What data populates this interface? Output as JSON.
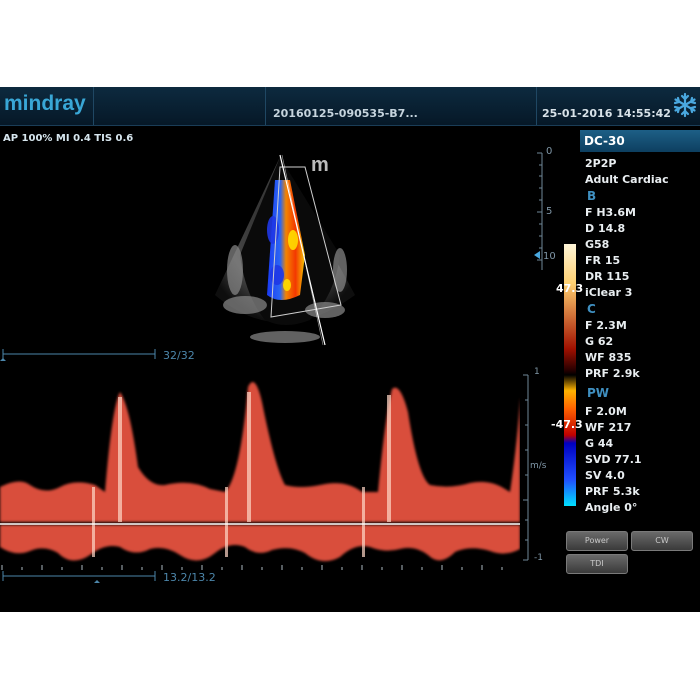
{
  "header": {
    "brand": "mindray",
    "study_id": "20160125-090535-B7...",
    "datetime": "25-01-2016 14:55:42",
    "freeze_icon": "snowflake-icon"
  },
  "acoustic": {
    "text": "AP 100%  MI 0.4 TIS 0.6"
  },
  "image": {
    "watermark": "m"
  },
  "depth_scale": {
    "labels": [
      "0",
      "5",
      "10"
    ]
  },
  "color_scale": {
    "top": "47.3",
    "bottom": "-47.3"
  },
  "doppler": {
    "scroll_top": "32/32",
    "scroll_bottom": "13.2/13.2",
    "velocity_top": "1",
    "velocity_bottom": "-1",
    "baseline_unit": "m/s"
  },
  "panel": {
    "probe": "DC-30",
    "preset": "2P2P",
    "exam": "Adult Cardiac",
    "b_header": "B",
    "b_params": [
      "F H3.6M",
      "D 14.8",
      "G58",
      "FR 15",
      "DR 115",
      "iClear 3"
    ],
    "c_header": "C",
    "c_params": [
      "F 2.3M",
      "G 62",
      "WF 835",
      "PRF 2.9k"
    ],
    "pw_header": "PW",
    "pw_params": [
      "F 2.0M",
      "WF 217",
      "G 44",
      "SVD 77.1",
      "SV 4.0",
      "PRF 5.3k",
      "Angle 0°"
    ]
  },
  "buttons": {
    "power": "Power",
    "cw": "CW",
    "tdi": "TDI"
  },
  "colors": {
    "accent": "#39a7d6",
    "panel_header": "#1d5f86",
    "doppler": "#ff6a52"
  }
}
